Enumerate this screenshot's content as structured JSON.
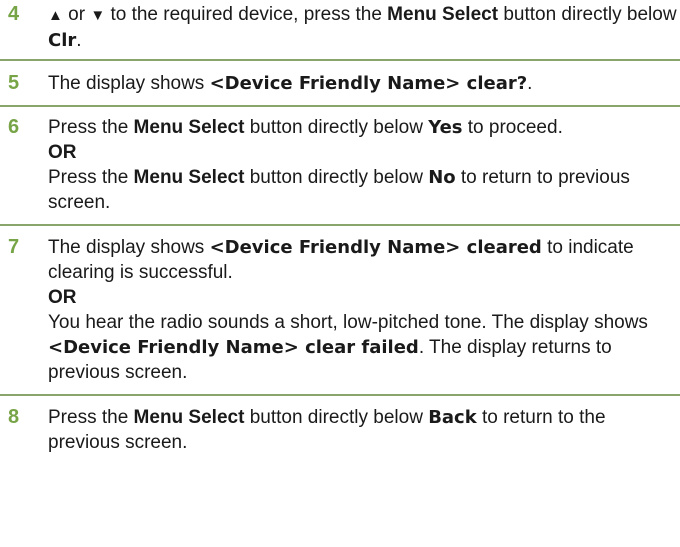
{
  "steps": [
    {
      "number": "4",
      "icon_up": "▲",
      "icon_down": "▼",
      "t1": " or ",
      "t2": " to the required device, press the ",
      "menu_select": "Menu Select",
      "t3": " button directly below ",
      "disp": "Clr",
      "t4": "."
    },
    {
      "number": "5",
      "t1": "The display shows ",
      "disp": "<Device Friendly Name> clear?",
      "t2": "."
    },
    {
      "number": "6",
      "a1": "Press the ",
      "menu_select": "Menu Select",
      "a2": " button directly below ",
      "a_disp": "Yes",
      "a3": " to proceed.",
      "or": "OR",
      "b1": "Press the ",
      "b2": " button directly below ",
      "b_disp": "No",
      "b3": " to return to previous screen."
    },
    {
      "number": "7",
      "a1": "The display shows ",
      "a_disp": "<Device Friendly Name> cleared",
      "a2": " to indicate clearing is successful.",
      "or": "OR",
      "b1": "You hear the radio sounds a short, low-pitched tone. The display shows ",
      "b_disp": "<Device Friendly Name> clear failed",
      "b2": ". The display returns to previous screen."
    },
    {
      "number": "8",
      "t1": "Press the ",
      "menu_select": "Menu Select",
      "t2": " button directly below ",
      "disp": "Back",
      "t3": " to return to the previous screen."
    }
  ]
}
